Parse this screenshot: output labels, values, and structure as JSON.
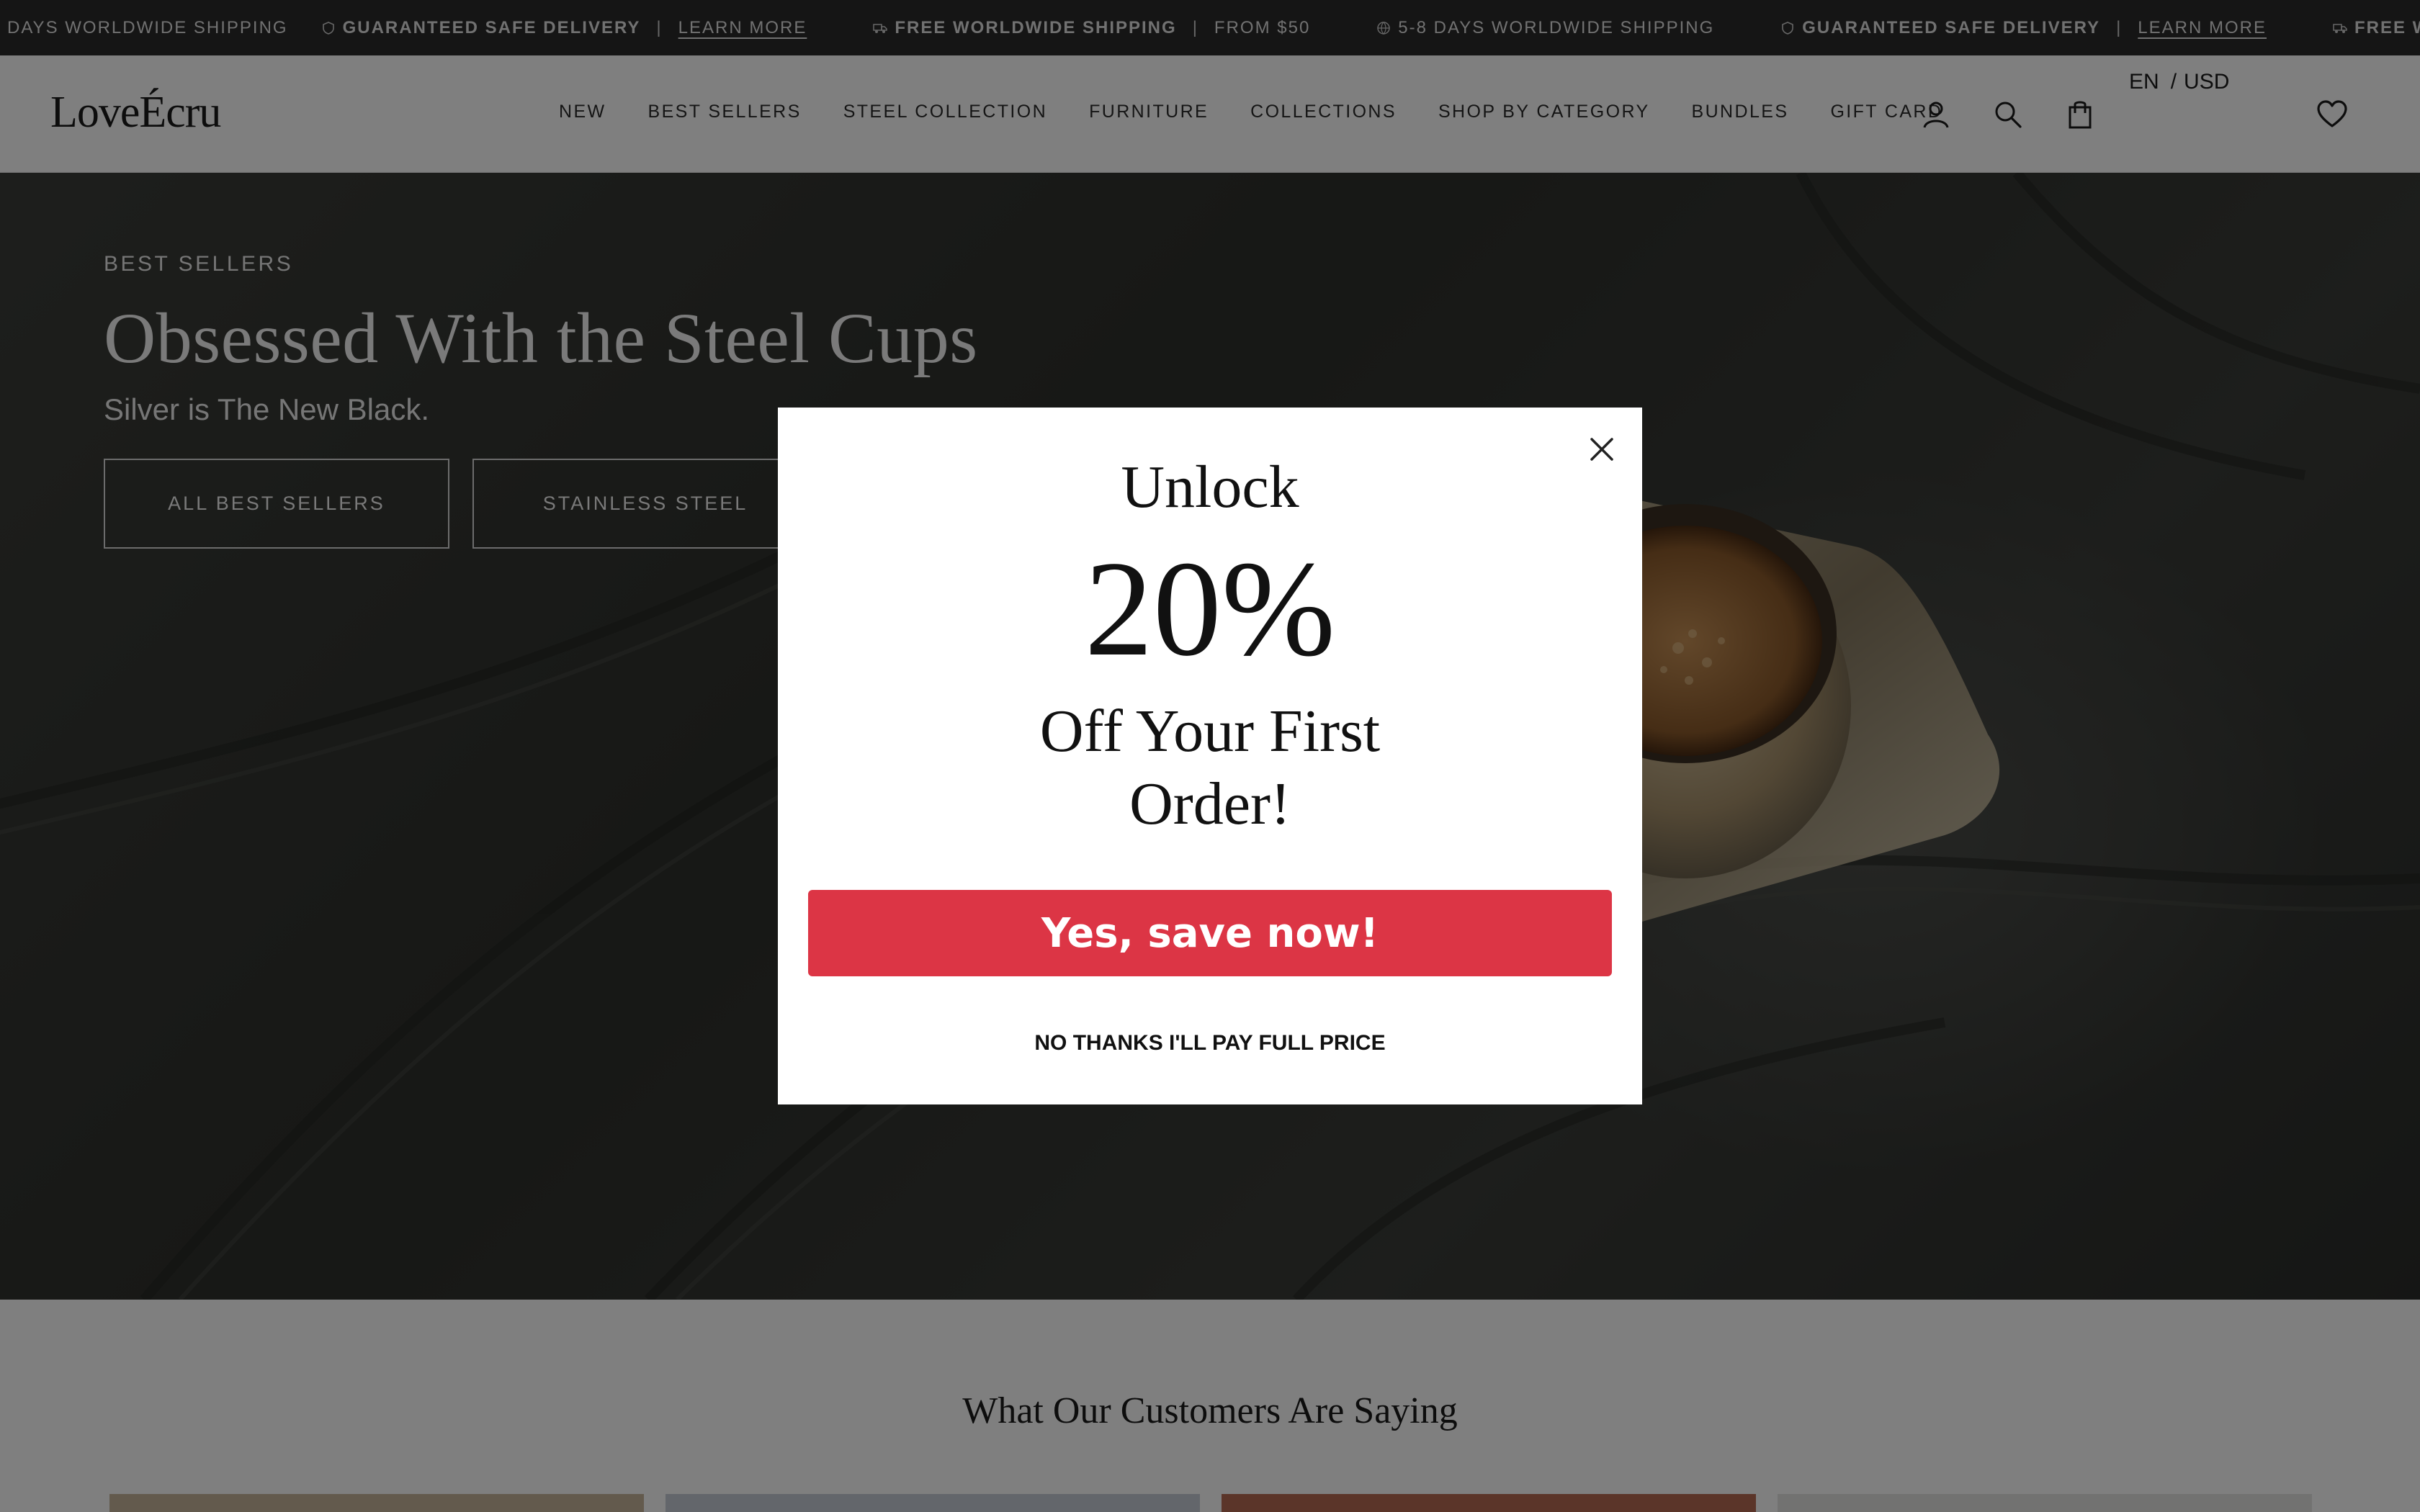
{
  "announcement": {
    "items": [
      {
        "icon": "globe-icon",
        "text": "DAYS WORLDWIDE SHIPPING",
        "bold": false
      },
      {
        "icon": "shield-icon",
        "text": "GUARANTEED SAFE DELIVERY",
        "bold": true,
        "link": "LEARN MORE"
      },
      {
        "icon": "truck-icon",
        "text": "FREE WORLDWIDE SHIPPING",
        "bold": true,
        "extra": "FROM $50"
      },
      {
        "icon": "globe-icon",
        "text": "5-8 DAYS WORLDWIDE SHIPPING",
        "bold": false
      },
      {
        "icon": "shield-icon",
        "text": "GUARANTEED SAFE DELIVERY",
        "bold": true,
        "link": "LEARN MORE"
      },
      {
        "icon": "truck-icon",
        "text": "FREE W",
        "bold": true
      }
    ],
    "separator": "|"
  },
  "header": {
    "logo": "LoveÉcru",
    "nav": [
      "NEW",
      "BEST SELLERS",
      "STEEL COLLECTION",
      "FURNITURE",
      "COLLECTIONS",
      "SHOP BY CATEGORY",
      "BUNDLES",
      "GIFT CARD"
    ],
    "icons": [
      "account-icon",
      "search-icon",
      "cart-icon",
      "wishlist-icon"
    ],
    "locale": {
      "language": "EN",
      "separator": "/",
      "currency": "USD"
    }
  },
  "hero": {
    "eyebrow": "BEST SELLERS",
    "title": "Obsessed With the Steel Cups",
    "subtitle": "Silver is The New Black.",
    "buttons": [
      "ALL BEST SELLERS",
      "STAINLESS STEEL"
    ]
  },
  "testimonials": {
    "title": "What Our Customers Are Saying",
    "card_colors": [
      "#c7b59b",
      "#c7ccd6",
      "#b76b52",
      "#e4e4e2"
    ]
  },
  "popup": {
    "line1": "Unlock",
    "line2": "20%",
    "line3": "Off Your First Order!",
    "cta": "Yes, save now!",
    "decline": "NO THANKS I'LL PAY FULL PRICE",
    "cta_color": "#dc3545"
  }
}
